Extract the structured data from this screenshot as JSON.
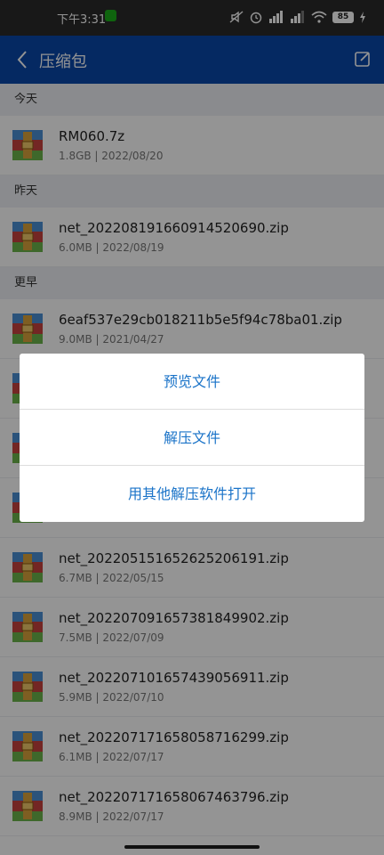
{
  "status_bar": {
    "time": "下午3:31",
    "battery": "85"
  },
  "app_bar": {
    "title": "压缩包"
  },
  "sections": [
    {
      "header": "今天",
      "files": [
        {
          "name": "RM060.7z",
          "meta": "1.8GB | 2022/08/20"
        }
      ]
    },
    {
      "header": "昨天",
      "files": [
        {
          "name": "net_202208191660914520690.zip",
          "meta": "6.0MB | 2022/08/19"
        }
      ]
    },
    {
      "header": "更早",
      "files": [
        {
          "name": "6eaf537e29cb018211b5e5f94c78ba01.zip",
          "meta": "9.0MB | 2021/04/27"
        },
        {
          "name": "",
          "meta": ""
        },
        {
          "name": "",
          "meta": ""
        },
        {
          "name": "",
          "meta": ""
        },
        {
          "name": "net_202205151652625206191.zip",
          "meta": "6.7MB | 2022/05/15"
        },
        {
          "name": "net_202207091657381849902.zip",
          "meta": "7.5MB | 2022/07/09"
        },
        {
          "name": "net_202207101657439056911.zip",
          "meta": "5.9MB | 2022/07/10"
        },
        {
          "name": "net_202207171658058716299.zip",
          "meta": "6.1MB | 2022/07/17"
        },
        {
          "name": "net_202207171658067463796.zip",
          "meta": "8.9MB | 2022/07/17"
        }
      ]
    }
  ],
  "dialog": {
    "items": [
      "预览文件",
      "解压文件",
      "用其他解压软件打开"
    ]
  },
  "colors": {
    "app_bar": "#0a47a9",
    "dialog_text": "#1a73c8"
  }
}
